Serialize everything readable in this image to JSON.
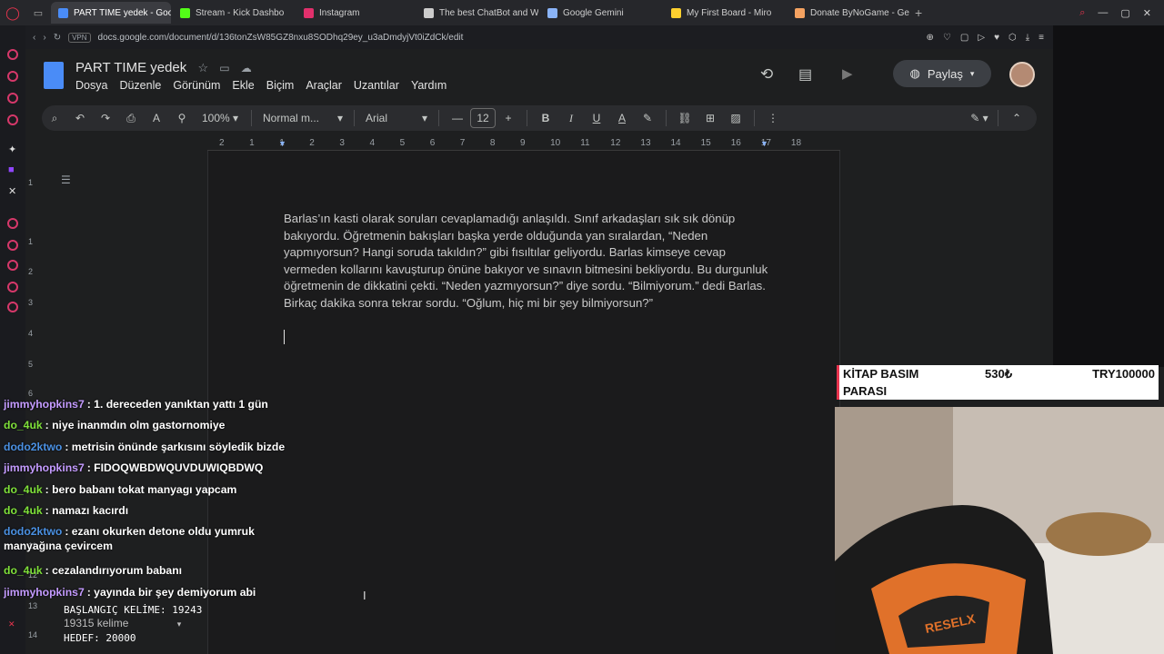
{
  "browser": {
    "tabs": [
      {
        "label": "PART TIME yedek - Goog",
        "color": "#4a8cf7",
        "active": true
      },
      {
        "label": "Stream - Kick Dashbo",
        "color": "#53fc18"
      },
      {
        "label": "Instagram",
        "color": "#e1306c"
      },
      {
        "label": "The best ChatBot and W",
        "color": "#cccccc"
      },
      {
        "label": "Google Gemini",
        "color": "#8ab4f8"
      },
      {
        "label": "My First Board - Miro",
        "color": "#ffd02f"
      },
      {
        "label": "Donate ByNoGame - Gele",
        "color": "#f4a261"
      }
    ],
    "url": "docs.google.com/document/d/136tonZsW85GZ8nxu8SODhq29ey_u3aDmdyjVt0iZdCk/edit",
    "vpn_label": "VPN"
  },
  "docs": {
    "title": "PART TIME  yedek",
    "menu": [
      "Dosya",
      "Düzenle",
      "Görünüm",
      "Ekle",
      "Biçim",
      "Araçlar",
      "Uzantılar",
      "Yardım"
    ],
    "share_label": "Paylaş",
    "toolbar": {
      "zoom": "100%",
      "style": "Normal m...",
      "font": "Arial",
      "size": "12"
    },
    "ruler_ticks": [
      "2",
      "1",
      "1",
      "2",
      "3",
      "4",
      "5",
      "6",
      "7",
      "8",
      "9",
      "10",
      "11",
      "12",
      "13",
      "14",
      "15",
      "16",
      "17",
      "18"
    ],
    "vruler_ticks": [
      "1",
      "1",
      "2",
      "3",
      "4",
      "5",
      "6",
      "11",
      "12",
      "13",
      "14"
    ],
    "body": "Barlas’ın kasti olarak soruları cevaplamadığı anlaşıldı. Sınıf arkadaşları sık sık dönüp bakıyordu. Öğretmenin bakışları başka yerde olduğunda yan sıralardan, “Neden yapmıyorsun? Hangi soruda takıldın?” gibi fısıltılar geliyordu. Barlas kimseye cevap vermeden kollarını kavuşturup önüne bakıyor ve sınavın bitmesini bekliyordu. Bu durgunluk öğretmenin de dikkatini çekti. “Neden yazmıyorsun?” diye sordu. “Bilmiyorum.” dedi Barlas. Birkaç dakika sonra tekrar sordu. “Oğlum, hiç mi bir şey bilmiyorsun?”"
  },
  "chat": [
    {
      "user": "jimmyhopkins7",
      "color": "#c49bff",
      "text": ": 1. dereceden yanıktan yattı 1 gün"
    },
    {
      "user": "do_4uk",
      "color": "#7fe03a",
      "text": ": niye inanmdın olm gastornomiye"
    },
    {
      "user": "dodo2ktwo",
      "color": "#4a90e2",
      "text": ": metrisin önünde şarkısını söyledik bizde"
    },
    {
      "user": "jimmyhopkins7",
      "color": "#c49bff",
      "text": ": FIDOQWBDWQUVDUWIQBDWQ"
    },
    {
      "user": "do_4uk",
      "color": "#7fe03a",
      "text": ": bero babanı tokat manyagı yapcam"
    },
    {
      "user": "do_4uk",
      "color": "#7fe03a",
      "text": ": namazı kacırdı"
    },
    {
      "user": "dodo2ktwo",
      "color": "#4a90e2",
      "text": ": ezanı okurken detone oldu yumruk manyağına çevircem"
    },
    {
      "user": "do_4uk",
      "color": "#7fe03a",
      "text": ": cezalandırıyorum babanı"
    },
    {
      "user": "jimmyhopkins7",
      "color": "#c49bff",
      "text": ": yayında bir şey demiyorum abi"
    }
  ],
  "counter": {
    "start": "BAŞLANGIÇ KELİME: 19243",
    "words": "19315 kelime",
    "target": "HEDEF: 20000"
  },
  "donation": {
    "line1": "KİTAP BASIM",
    "line2": "PARASI",
    "amount": "530₺",
    "target": "TRY100000"
  }
}
